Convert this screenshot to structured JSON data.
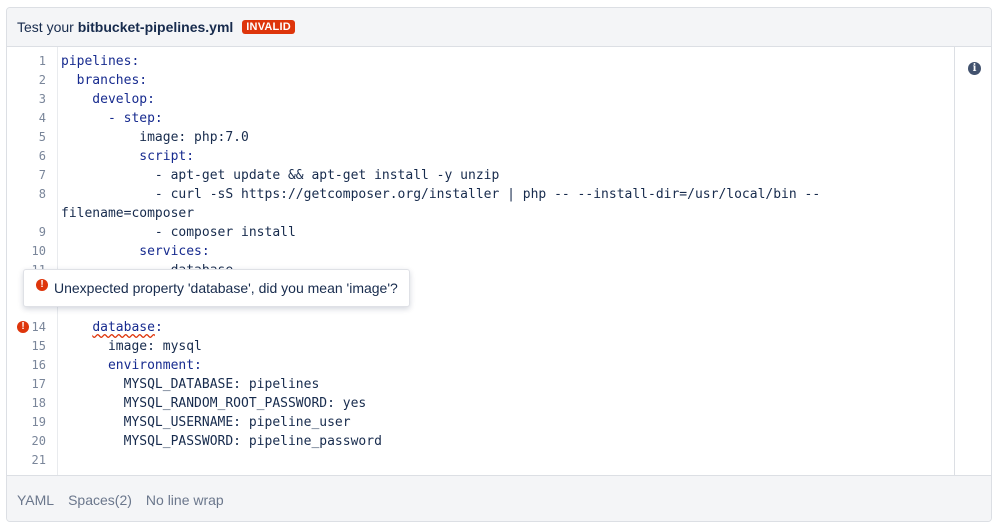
{
  "header": {
    "prefix": "Test your ",
    "filename": "bitbucket-pipelines.yml",
    "badge": "INVALID"
  },
  "editor": {
    "lines": [
      {
        "num": "1",
        "text": "pipelines:"
      },
      {
        "num": "2",
        "text": "  branches:"
      },
      {
        "num": "3",
        "text": "    develop:"
      },
      {
        "num": "4",
        "text": "      - step:"
      },
      {
        "num": "5",
        "text": "          image: php:7.0"
      },
      {
        "num": "6",
        "text": "          script:"
      },
      {
        "num": "7",
        "text": "            - apt-get update && apt-get install -y unzip"
      },
      {
        "num": "8",
        "text": "            - curl -sS https://getcomposer.org/installer | php -- --install-dir=/usr/local/bin --"
      },
      {
        "num": "",
        "text": "filename=composer"
      },
      {
        "num": "9",
        "text": "            - composer install"
      },
      {
        "num": "10",
        "text": "          services:"
      },
      {
        "num": "11",
        "text": "            - database"
      },
      {
        "num": "14",
        "text": "    database:"
      },
      {
        "num": "15",
        "text": "      image: mysql"
      },
      {
        "num": "16",
        "text": "      environment:"
      },
      {
        "num": "17",
        "text": "        MYSQL_DATABASE: pipelines"
      },
      {
        "num": "18",
        "text": "        MYSQL_RANDOM_ROOT_PASSWORD: yes"
      },
      {
        "num": "19",
        "text": "        MYSQL_USERNAME: pipeline_user"
      },
      {
        "num": "20",
        "text": "        MYSQL_PASSWORD: pipeline_password"
      },
      {
        "num": "21",
        "text": ""
      }
    ],
    "error_marker": "!"
  },
  "tooltip": {
    "icon": "!",
    "message": "Unexpected property 'database', did you mean 'image'?"
  },
  "info_icon": "i",
  "footer": {
    "language": "YAML",
    "indent": "Spaces(2)",
    "wrap": "No line wrap"
  },
  "colors": {
    "error": "#de350b",
    "key": "#172b8f",
    "number": "#00875a",
    "boolean": "#6b2ea6"
  }
}
